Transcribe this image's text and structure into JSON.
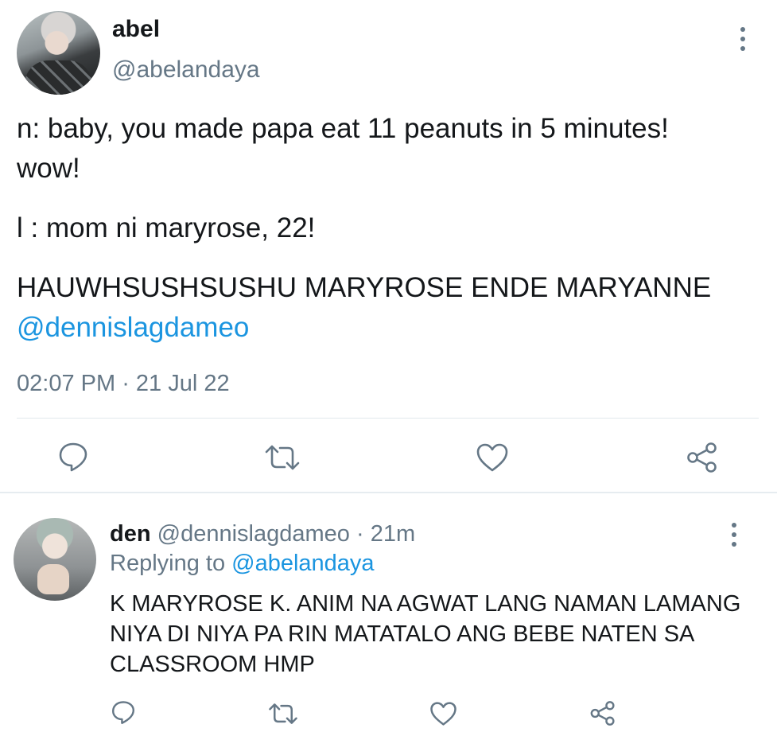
{
  "tweet": {
    "author_name": "abel",
    "author_handle": "@abelandaya",
    "line1": "n: baby, you made papa eat 11 peanuts in 5 minutes! wow!",
    "line2": "l : mom ni maryrose, 22!",
    "line3_text": "HAUWHSUSHSUSHU MARYROSE ENDE MARYANNE ",
    "line3_mention": "@dennislagdameo",
    "time": "02:07 PM",
    "date_sep": " · ",
    "date": "21 Jul 22"
  },
  "reply": {
    "author_name": "den",
    "author_handle": "@dennislagdameo",
    "age_sep": " · ",
    "age": "21m",
    "replying_label": "Replying to ",
    "replying_to": "@abelandaya",
    "text": "K MARYROSE K. ANIM NA AGWAT LANG NAMAN LAMANG NIYA DI NIYA PA RIN MATATALO ANG BEBE NATEN SA CLASSROOM HMP"
  },
  "icons": {
    "reply": "reply-icon",
    "retweet": "retweet-icon",
    "like": "heart-icon",
    "share": "share-icon",
    "more": "more-vertical-icon"
  },
  "colors": {
    "text": "#14171a",
    "secondary": "#657786",
    "link": "#1b95e0",
    "divider": "#e1e8ed"
  }
}
